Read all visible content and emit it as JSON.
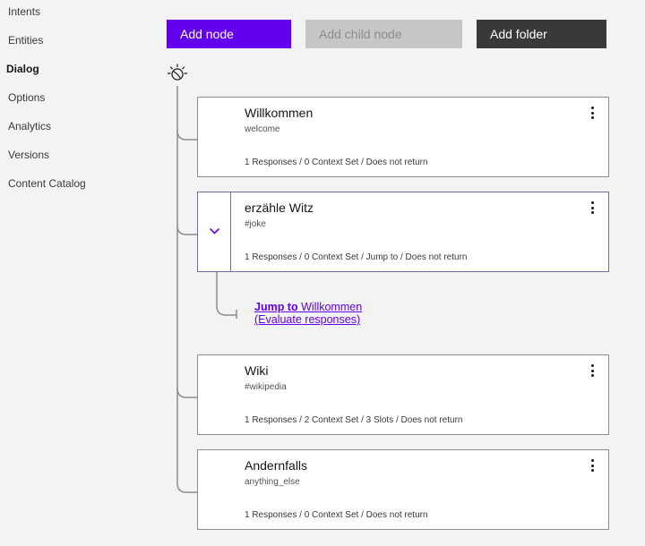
{
  "sidebar": {
    "items": [
      {
        "label": "Intents",
        "active": false
      },
      {
        "label": "Entities",
        "active": false
      },
      {
        "label": "Dialog",
        "active": true
      },
      {
        "label": "Options",
        "active": false
      },
      {
        "label": "Analytics",
        "active": false
      },
      {
        "label": "Versions",
        "active": false
      },
      {
        "label": "Content Catalog",
        "active": false
      }
    ]
  },
  "toolbar": {
    "add_node": "Add node",
    "add_child_node": "Add child node",
    "add_folder": "Add folder"
  },
  "nodes": [
    {
      "title": "Willkommen",
      "condition": "welcome",
      "meta": "1 Responses / 0 Context Set / Does not return"
    },
    {
      "title": "erzähle Witz",
      "condition": "#joke",
      "meta": "1 Responses / 0 Context Set / Jump to / Does not return",
      "expanded": true
    },
    {
      "title": "Wiki",
      "condition": "#wikipedia",
      "meta": "1 Responses / 2 Context Set / 3 Slots / Does not return"
    },
    {
      "title": "Andernfalls",
      "condition": "anything_else",
      "meta": "1 Responses / 0 Context Set / Does not return"
    }
  ],
  "jump": {
    "prefix": "Jump to",
    "target": "Willkommen",
    "mode": "(Evaluate responses)"
  },
  "colors": {
    "accent": "#6200ee",
    "dark_button": "#393939",
    "disabled_button": "#c6c6c6",
    "background": "#f3f3f3"
  },
  "icons": [
    "root-node-icon",
    "overflow-menu-icon",
    "chevron-down-icon"
  ]
}
